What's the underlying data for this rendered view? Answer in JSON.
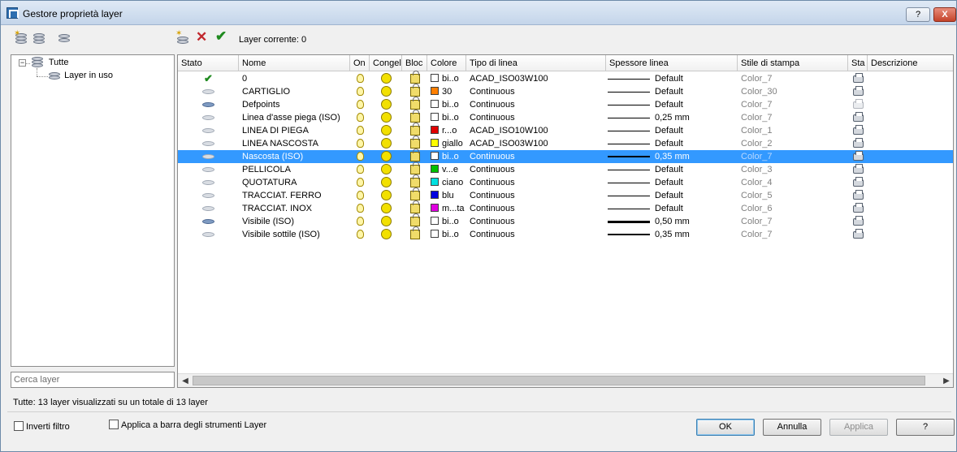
{
  "window": {
    "title": "Gestore proprietà layer",
    "help_button": "?",
    "close_button": "X"
  },
  "toolbar": {
    "current_layer": "Layer corrente: 0"
  },
  "tree": {
    "root": "Tutte",
    "child": "Layer in uso",
    "toggle": "−"
  },
  "search": {
    "placeholder": "Cerca layer"
  },
  "columns": [
    "Stato",
    "Nome",
    "On",
    "Congel",
    "Bloc",
    "Colore",
    "Tipo di linea",
    "Spessore linea",
    "Stile di stampa",
    "Sta",
    "Descrizione"
  ],
  "layers": [
    {
      "status": "current",
      "name": "0",
      "color_name": "bi..o",
      "color_hex": "#ffffff",
      "linetype": "ACAD_ISO03W100",
      "lineweight": "Default",
      "plot_style": "Color_7",
      "plot": true
    },
    {
      "status": "layer",
      "name": "CARTIGLIO",
      "color_name": "30",
      "color_hex": "#ff7f00",
      "linetype": "Continuous",
      "lineweight": "Default",
      "plot_style": "Color_30",
      "plot": true
    },
    {
      "status": "layer-blue",
      "name": "Defpoints",
      "color_name": "bi..o",
      "color_hex": "#ffffff",
      "linetype": "Continuous",
      "lineweight": "Default",
      "plot_style": "Color_7",
      "plot": false
    },
    {
      "status": "layer",
      "name": "Linea d'asse piega (ISO)",
      "color_name": "bi..o",
      "color_hex": "#ffffff",
      "linetype": "Continuous",
      "lineweight": "0,25 mm",
      "plot_style": "Color_7",
      "plot": true
    },
    {
      "status": "layer",
      "name": "LINEA DI PIEGA",
      "color_name": "r...o",
      "color_hex": "#e00000",
      "linetype": "ACAD_ISO10W100",
      "lineweight": "Default",
      "plot_style": "Color_1",
      "plot": true
    },
    {
      "status": "layer",
      "name": "LINEA NASCOSTA",
      "color_name": "giallo",
      "color_hex": "#ffff00",
      "linetype": "ACAD_ISO03W100",
      "lineweight": "Default",
      "plot_style": "Color_2",
      "plot": true
    },
    {
      "status": "layer",
      "name": "Nascosta (ISO)",
      "color_name": "bi..o",
      "color_hex": "#ffffff",
      "linetype": "Continuous",
      "lineweight": "0,35 mm",
      "plot_style": "Color_7",
      "plot": true
    },
    {
      "status": "layer",
      "name": "PELLICOLA",
      "color_name": "v...e",
      "color_hex": "#00c000",
      "linetype": "Continuous",
      "lineweight": "Default",
      "plot_style": "Color_3",
      "plot": true
    },
    {
      "status": "layer",
      "name": "QUOTATURA",
      "color_name": "ciano",
      "color_hex": "#00e0e0",
      "linetype": "Continuous",
      "lineweight": "Default",
      "plot_style": "Color_4",
      "plot": true
    },
    {
      "status": "layer",
      "name": "TRACCIAT. FERRO",
      "color_name": "blu",
      "color_hex": "#0000e0",
      "linetype": "Continuous",
      "lineweight": "Default",
      "plot_style": "Color_5",
      "plot": true
    },
    {
      "status": "layer",
      "name": "TRACCIAT. INOX",
      "color_name": "m...ta",
      "color_hex": "#e000e0",
      "linetype": "Continuous",
      "lineweight": "Default",
      "plot_style": "Color_6",
      "plot": true
    },
    {
      "status": "layer-blue",
      "name": "Visibile (ISO)",
      "color_name": "bi..o",
      "color_hex": "#ffffff",
      "linetype": "Continuous",
      "lineweight": "0,50 mm",
      "plot_style": "Color_7",
      "plot": true
    },
    {
      "status": "layer",
      "name": "Visibile sottile (ISO)",
      "color_name": "bi..o",
      "color_hex": "#ffffff",
      "linetype": "Continuous",
      "lineweight": "0,35 mm",
      "plot_style": "Color_7",
      "plot": true
    }
  ],
  "selected_index": 6,
  "summary": "Tutte: 13 layer visualizzati su un totale di 13 layer",
  "options": {
    "invert_filter": "Inverti filtro",
    "apply_toolbar": "Applica a barra degli strumenti Layer"
  },
  "buttons": {
    "ok": "OK",
    "cancel": "Annulla",
    "apply": "Applica",
    "help": "?"
  },
  "colors": {
    "selection": "#3399ff",
    "current_check": "#1f8a1f",
    "delete_x": "#c1272d"
  }
}
